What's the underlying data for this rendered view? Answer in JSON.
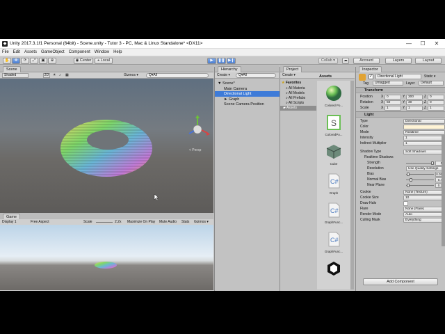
{
  "window": {
    "title": "Unity 2017.3.1f1 Personal (64bit) - Scene.unity - Tutor 3 - PC, Mac & Linux Standalone* <DX11>",
    "controls": [
      "—",
      "☐",
      "✕"
    ]
  },
  "menu": [
    "File",
    "Edit",
    "Assets",
    "GameObject",
    "Component",
    "Window",
    "Help"
  ],
  "toolbar": {
    "center": "Center",
    "local": "Local",
    "collab": "Collab ▾",
    "account": "Account",
    "layers": "Layers",
    "layout": "Layout"
  },
  "scene": {
    "tab": "Scene",
    "shading": "Shaded",
    "mode2d": "2D",
    "gizmos": "Gizmos ▾",
    "search": "Q▾All",
    "persp": "< Persp"
  },
  "game": {
    "tab": "Game",
    "display": "Display 1",
    "aspect": "Free Aspect",
    "scale_label": "Scale",
    "scale_value": "2.2x",
    "maximize": "Maximize On Play",
    "mute": "Mute Audio",
    "stats": "Stats",
    "gizmos": "Gizmos ▾"
  },
  "hierarchy": {
    "tab": "Hierarchy",
    "create": "Create ▾",
    "search": "Q▾All",
    "items": [
      {
        "label": "▼ Scene*",
        "indent": 0,
        "selected": false
      },
      {
        "label": "Main Camera",
        "indent": 1,
        "selected": false
      },
      {
        "label": "Directional Light",
        "indent": 1,
        "selected": true
      },
      {
        "label": "► Graph",
        "indent": 1,
        "selected": false
      },
      {
        "label": "Scene Camera Position",
        "indent": 1,
        "selected": false
      }
    ]
  },
  "project": {
    "tab": "Project",
    "create": "Create ▾",
    "favorites_title": "Favorites",
    "favorites": [
      "All Materia",
      "All Models",
      "All Prefabs",
      "All Scripts"
    ],
    "assets_folder": "Assets",
    "assets_header": "Assets",
    "assets": [
      {
        "label": "Colored Po...",
        "icon": "sphere-material-icon"
      },
      {
        "label": "ColoredPo...",
        "icon": "shader-icon"
      },
      {
        "label": "Cube",
        "icon": "prefab-cube-icon"
      },
      {
        "label": "Graph",
        "icon": "csharp-script-icon"
      },
      {
        "label": "GraphFunc...",
        "icon": "csharp-script-icon"
      },
      {
        "label": "GraphFunc...",
        "icon": "csharp-script-icon"
      },
      {
        "label": "",
        "icon": "unity-scene-icon"
      }
    ]
  },
  "inspector": {
    "tab": "Inspector",
    "object_name": "Directional Light",
    "static": "Static ▾",
    "tag_label": "Tag",
    "tag": "Untagged",
    "layer_label": "Layer",
    "layer": "Default",
    "transform": {
      "title": "Transform",
      "rows": [
        {
          "label": "Position",
          "x": "0",
          "y": "300",
          "z": "0"
        },
        {
          "label": "Rotation",
          "x": "50",
          "y": "30",
          "z": "0"
        },
        {
          "label": "Scale",
          "x": "1",
          "y": "1",
          "z": "1"
        }
      ]
    },
    "light": {
      "title": "Light",
      "rows": [
        {
          "label": "Type",
          "value": "Directional"
        },
        {
          "label": "Color",
          "value": ""
        },
        {
          "label": "Mode",
          "value": "Realtime"
        },
        {
          "label": "Intensity",
          "value": "1"
        },
        {
          "label": "Indirect Multiplier",
          "value": "1"
        },
        {
          "label": "Shadow Type",
          "value": "Soft Shadows"
        }
      ],
      "realtime_shadows": "Realtime Shadows",
      "sliders": [
        {
          "label": "Strength",
          "value": "1",
          "fraction": 1.0
        },
        {
          "label": "Resolution",
          "value": "Use Quality Settings",
          "fraction": null
        },
        {
          "label": "Bias",
          "value": "0.05",
          "fraction": 0.025
        },
        {
          "label": "Normal Bias",
          "value": "0.4",
          "fraction": 0.13
        },
        {
          "label": "Near Plane",
          "value": "0.2",
          "fraction": 0.02
        }
      ],
      "rows2": [
        {
          "label": "Cookie",
          "value": "None (Texture)"
        },
        {
          "label": "Cookie Size",
          "value": "10"
        },
        {
          "label": "Draw Halo",
          "value": ""
        },
        {
          "label": "Flare",
          "value": "None (Flare)"
        },
        {
          "label": "Render Mode",
          "value": "Auto"
        },
        {
          "label": "Culling Mask",
          "value": "Everything"
        }
      ]
    },
    "add_component": "Add Component"
  }
}
